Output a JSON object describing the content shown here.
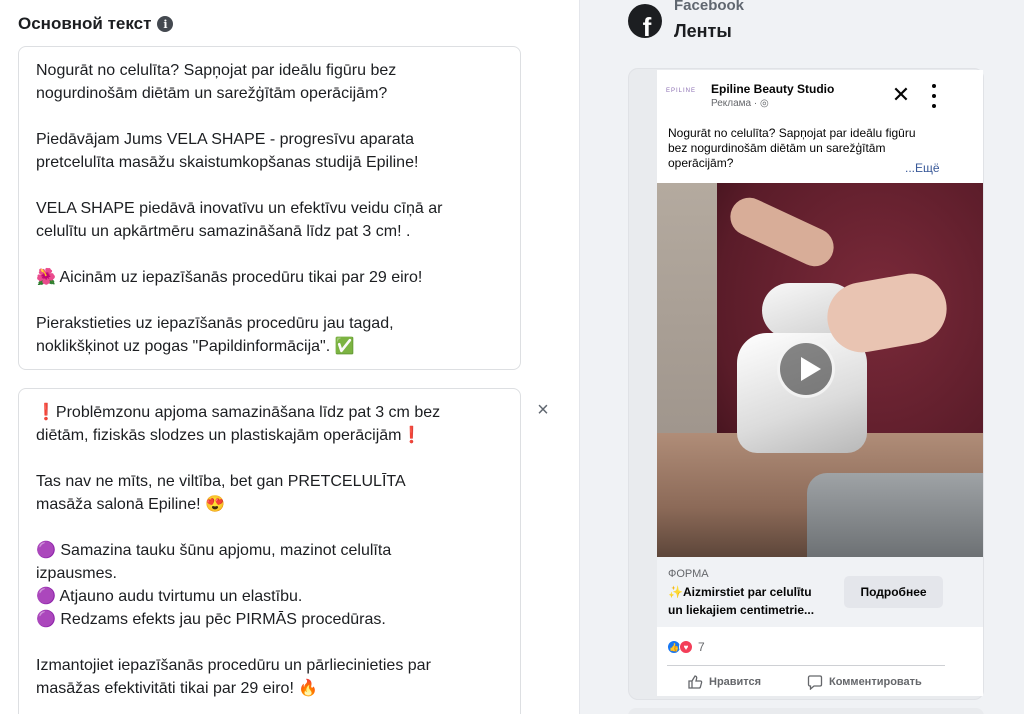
{
  "left": {
    "section_title": "Основной текст",
    "info_icon": "i",
    "text1": [
      [
        "Nogurāt no celulīta? Sapņojat par ideālu figūru bez",
        "nogurdinošām diētām un sarežģītām operācijām?"
      ],
      [
        "Piedāvājam Jums VELA SHAPE - progresīvu aparata",
        "pretcelulīta masāžu skaistumkopšanas studijā Epiline!"
      ],
      [
        "VELA SHAPE piedāvā inovatīvu un efektīvu veidu cīņā ar",
        "celulītu un apkārtmēru samazināšanā līdz pat 3 cm! ."
      ],
      [
        "🌺 Aicinām uz iepazīšanās procedūru tikai par 29 eiro!"
      ],
      [
        "Pierakstieties uz iepazīšanās procedūru jau tagad,",
        "noklikšķinot uz pogas \"Papildinformācija\". ✅"
      ]
    ],
    "text2": [
      [
        "❗Problēmzonu apjoma samazināšana līdz pat 3 cm bez",
        "diētām, fiziskās slodzes un plastiskajām operācijām❗"
      ],
      [
        "Tas nav ne mīts, ne viltība, bet gan PRETCELULĪTA",
        "masāža salonā Epiline! 😍"
      ],
      [
        "🟣 Samazina tauku šūnu apjomu, mazinot celulīta",
        "izpausmes.",
        "🟣 Atjauno audu tvirtumu un elastību.",
        "🟣 Redzams efekts jau pēc PIRMĀS procedūras."
      ],
      [
        "Izmantojiet iepazīšanās procedūru un pārliecinieties par",
        "masāžas efektivitāti tikai par 29 eiro! 🔥"
      ]
    ],
    "remove_icon": "×"
  },
  "preview": {
    "platform": "Facebook",
    "placement": "Ленты",
    "fb_logo": "f",
    "page_logo_text": "EPILINE",
    "page_name": "Epiline Beauty Studio",
    "sponsored": "Реклама · ◎",
    "close_icon": "✕",
    "post_text_lines": [
      "Nogurāt no celulīta? Sapņojat par ideālu figūru",
      "bez nogurdinošām diētām un sarežģītām",
      "operācijām?"
    ],
    "see_more": "...Ещё",
    "cta_label": "ФОРМА",
    "cta_headline_lines": [
      "✨Aizmirstiet par celulītu",
      "un liekajiem centimetrie..."
    ],
    "cta_button": "Подробнее",
    "reaction_count": "7",
    "like_action": "Нравится",
    "comment_action": "Комментировать",
    "colors": {
      "like": "#1877f2",
      "love": "#f33e58",
      "link": "#385898"
    }
  }
}
